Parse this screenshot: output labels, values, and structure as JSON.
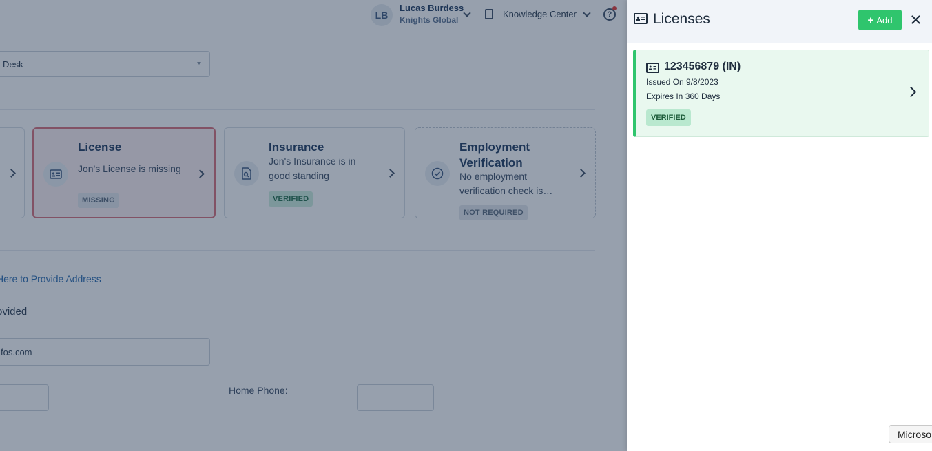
{
  "topbar": {
    "user_initials": "LB",
    "user_name": "Lucas Burdess",
    "user_org": "Knights Global",
    "knowledge_center_label": "Knowledge Center",
    "help_label": "?"
  },
  "main": {
    "select_value": "Desk",
    "cards": [
      {
        "title": "License",
        "description": "Jon's License is missing",
        "status": "MISSING"
      },
      {
        "title": "Insurance",
        "description_line1": "Jon's Insurance is in",
        "description_line2": "good standing",
        "status": "VERIFIED"
      },
      {
        "title_line1": "Employment",
        "title_line2": "Verification",
        "description_line1": "No employment",
        "description_line2": "verification check is…",
        "status": "NOT REQUIRED"
      }
    ],
    "address_link": "Here to Provide Address",
    "provided_text": "ovided",
    "email_value": "fos.com",
    "home_phone_label": "Home Phone:"
  },
  "drawer": {
    "title": "Licenses",
    "add_label": "Add",
    "license": {
      "number": "123456879 (IN)",
      "issued": "Issued On 9/8/2023",
      "expires": "Expires In 360 Days",
      "status": "VERIFIED"
    }
  },
  "tooltip": {
    "text": "Microso"
  },
  "colors": {
    "accent_green": "#2fc56d",
    "license_card_bg": "#e9f8ef",
    "overlay": "rgba(28, 49, 77, 0.46)",
    "missing_border": "#d9707a",
    "link_blue": "#2b6cb0"
  },
  "icons": {
    "license": "id-card-icon",
    "insurance": "document-search-icon",
    "employment": "check-circle-icon",
    "close": "close-icon",
    "chevron": "chevron-right-icon"
  }
}
